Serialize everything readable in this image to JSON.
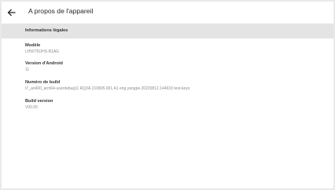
{
  "header": {
    "title": "A propos de l'appareil",
    "back_icon": "arrow-left-icon"
  },
  "section": {
    "label": "Informations légales"
  },
  "items": [
    {
      "title": "Modèle",
      "value": "LH5075UHS-B1AG"
    },
    {
      "title": "Version d'Android",
      "value": "11"
    },
    {
      "title": "Numéro de build",
      "value": "t7_an400_arm64-userdebug11 RQ3A.210805.001.A1 eng.yangpe.20220812.144633 test-keys"
    },
    {
      "title": "Build version",
      "value": "V00.05"
    }
  ],
  "colors": {
    "background": "#ffffff",
    "section_header_bg": "#e4e4e4",
    "title_text": "#333333",
    "value_text": "#8c8c8c"
  }
}
